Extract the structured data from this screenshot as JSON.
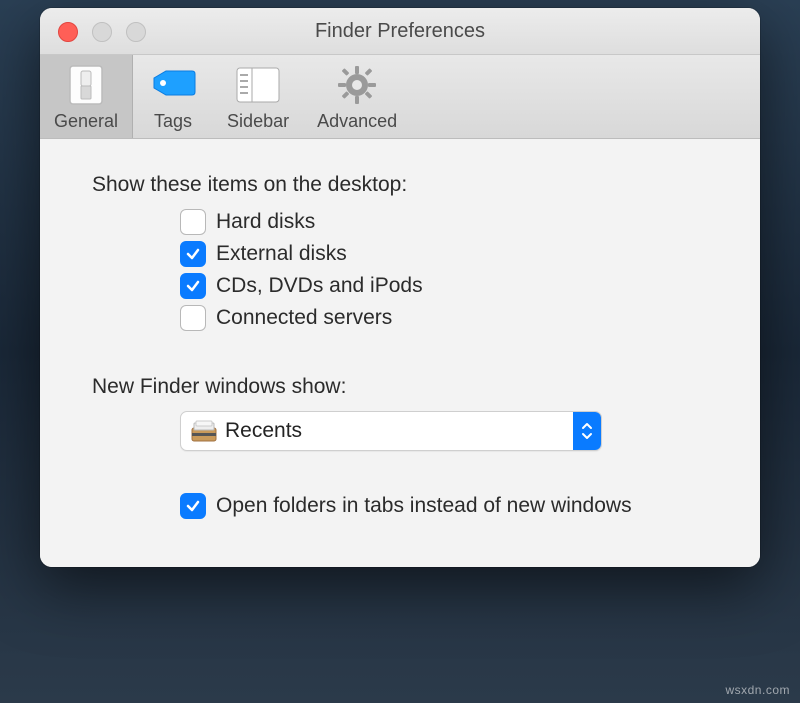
{
  "window": {
    "title": "Finder Preferences"
  },
  "toolbar": {
    "tabs": [
      {
        "label": "General",
        "selected": true
      },
      {
        "label": "Tags",
        "selected": false
      },
      {
        "label": "Sidebar",
        "selected": false
      },
      {
        "label": "Advanced",
        "selected": false
      }
    ]
  },
  "desktop_items": {
    "heading": "Show these items on the desktop:",
    "options": [
      {
        "label": "Hard disks",
        "checked": false
      },
      {
        "label": "External disks",
        "checked": true
      },
      {
        "label": "CDs, DVDs and iPods",
        "checked": true
      },
      {
        "label": "Connected servers",
        "checked": false
      }
    ]
  },
  "new_windows": {
    "heading": "New Finder windows show:",
    "selected": "Recents"
  },
  "folders_in_tabs": {
    "label": "Open folders in tabs instead of new windows",
    "checked": true
  },
  "watermark": "wsxdn.com",
  "colors": {
    "accent": "#0a7bff"
  }
}
